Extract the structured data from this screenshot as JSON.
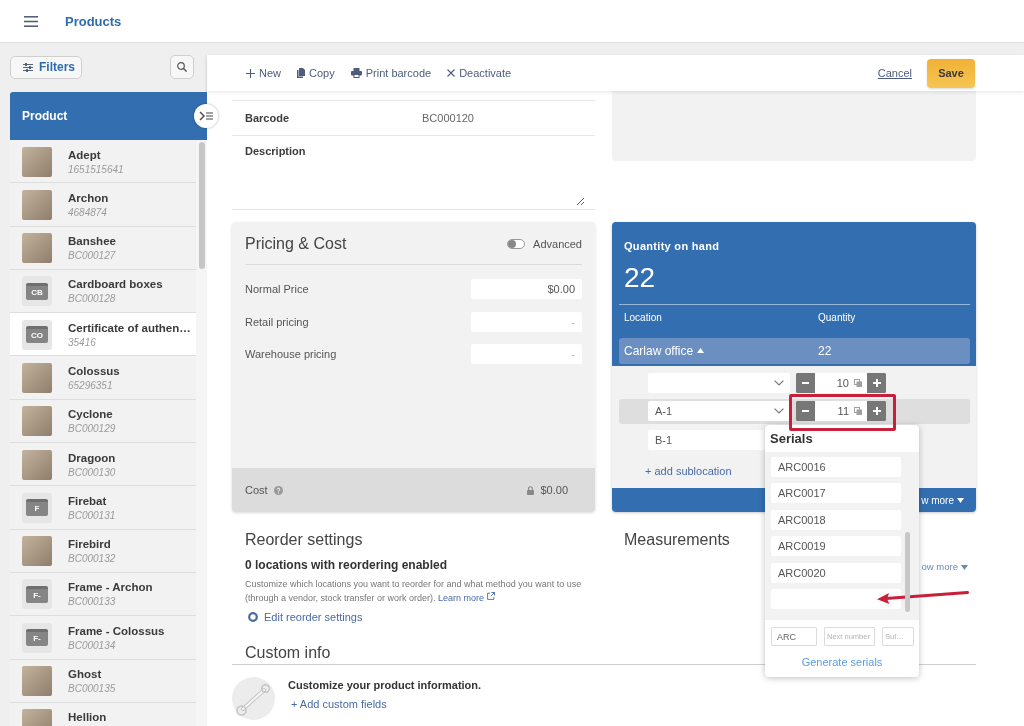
{
  "topbar": {
    "title": "Products"
  },
  "sidebar": {
    "filters_label": "Filters",
    "list_header": "Product",
    "items": [
      {
        "name": "Adept",
        "code": "1651515641",
        "kind": "photo",
        "selected": false
      },
      {
        "name": "Archon",
        "code": "4684874",
        "kind": "photo",
        "selected": false
      },
      {
        "name": "Banshee",
        "code": "BC000127",
        "kind": "photo",
        "selected": false
      },
      {
        "name": "Cardboard boxes",
        "code": "BC000128",
        "kind": "placeholder",
        "initials": "CB",
        "selected": false
      },
      {
        "name": "Certificate of authen…",
        "code": "35416",
        "kind": "placeholder",
        "initials": "CO",
        "selected": true
      },
      {
        "name": "Colossus",
        "code": "65296351",
        "kind": "photo",
        "selected": false
      },
      {
        "name": "Cyclone",
        "code": "BC000129",
        "kind": "photo",
        "selected": false
      },
      {
        "name": "Dragoon",
        "code": "BC000130",
        "kind": "photo",
        "selected": false
      },
      {
        "name": "Firebat",
        "code": "BC000131",
        "kind": "placeholder",
        "initials": "F",
        "selected": false
      },
      {
        "name": "Firebird",
        "code": "BC000132",
        "kind": "photo",
        "selected": false
      },
      {
        "name": "Frame - Archon",
        "code": "BC000133",
        "kind": "placeholder",
        "initials": "F-",
        "selected": false
      },
      {
        "name": "Frame - Colossus",
        "code": "BC000134",
        "kind": "placeholder",
        "initials": "F-",
        "selected": false
      },
      {
        "name": "Ghost",
        "code": "BC000135",
        "kind": "photo",
        "selected": false
      },
      {
        "name": "Hellion",
        "kind": "photo",
        "selected": false
      }
    ]
  },
  "toolbar": {
    "actions": [
      {
        "kind": "new",
        "label": "New"
      },
      {
        "kind": "copy",
        "label": "Copy"
      },
      {
        "kind": "print",
        "label": "Print barcode"
      },
      {
        "kind": "deactivate",
        "label": "Deactivate"
      }
    ],
    "cancel": "Cancel",
    "save": "Save"
  },
  "details": {
    "fields": [
      {
        "kind": "text",
        "label": "Barcode",
        "value": "BC000120"
      },
      {
        "kind": "textarea",
        "label": "Description"
      }
    ]
  },
  "pricing": {
    "title": "Pricing & Cost",
    "advanced": {
      "label": "Advanced",
      "on": false
    },
    "rows": [
      {
        "label": "Normal Price",
        "value": "$0.00"
      },
      {
        "label": "Retail pricing",
        "placeholder": "-"
      },
      {
        "label": "Warehouse pricing",
        "placeholder": "-"
      }
    ],
    "cost": {
      "label": "Cost",
      "value": "$0.00",
      "locked": true
    }
  },
  "quantity": {
    "title": "Quantity on hand",
    "total": "22",
    "columns": [
      "Location",
      "Quantity"
    ],
    "location": {
      "name": "Carlaw office",
      "quantity": "22",
      "expanded": true
    },
    "sublocations": [
      {
        "quantity": "10",
        "selected": false,
        "highlighted": false
      },
      {
        "name": "A-1",
        "quantity": "11",
        "selected": true,
        "highlighted": true
      },
      {
        "name": "B-1",
        "selected": false,
        "highlighted": false
      }
    ],
    "add_label": "+ add sublocation",
    "footer_more": "w more"
  },
  "serials_popup": {
    "title": "Serials",
    "items": [
      {
        "kind": "filled",
        "value": "ARC0016",
        "pointed_at": false
      },
      {
        "kind": "filled",
        "value": "ARC0017",
        "pointed_at": false
      },
      {
        "kind": "filled",
        "value": "ARC0018",
        "pointed_at": false
      },
      {
        "kind": "filled",
        "value": "ARC0019",
        "pointed_at": false
      },
      {
        "kind": "filled",
        "value": "ARC0020",
        "pointed_at": false
      },
      {
        "kind": "blank",
        "pointed_at": true
      }
    ],
    "prefix": "ARC",
    "number_placeholder": "Next number",
    "suffix_placeholder": "Suf…",
    "generate": "Generate serials"
  },
  "reorder": {
    "title": "Reorder settings",
    "summary": "0 locations with reordering enabled",
    "description": "Customize which locations you want to reorder for and what method you want to use (through a vendor, stock transfer or work order).",
    "learn_more": "Learn more",
    "edit": "Edit reorder settings"
  },
  "measurements": {
    "title": "Measurements",
    "more": "ow more"
  },
  "custom_info": {
    "title": "Custom info",
    "prompt": "Customize your product information.",
    "add": "+ Add custom fields"
  }
}
